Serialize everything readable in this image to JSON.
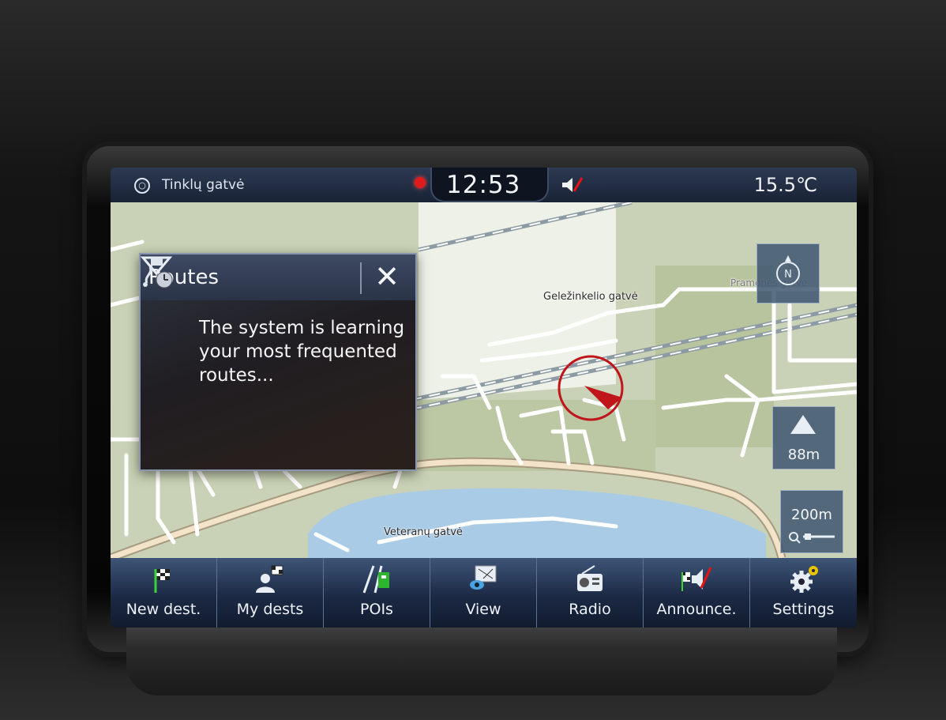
{
  "status_bar": {
    "street": "Tinklų gatvė",
    "time": "12:53",
    "temperature": "15.5℃"
  },
  "map": {
    "streets": {
      "gelezinkelio": "Geležinkelio gatvė",
      "pramones": "Pramonės gatvė",
      "veteranu": "Veteranų gatvė"
    },
    "altitude": "88m",
    "scale": "200m",
    "colors": {
      "land": "#c9d2b6",
      "industrial": "#eef1e8",
      "water": "#a9cbe6",
      "road": "#ffffff",
      "main_road": "#f3e3c8",
      "position_marker": "#c0161b"
    }
  },
  "routes_popup": {
    "title": "Routes",
    "message": "The system is learning your most frequented routes..."
  },
  "bottom_nav": {
    "items": [
      {
        "label": "New dest.",
        "icon": "checkered-flag-icon"
      },
      {
        "label": "My dests",
        "icon": "person-flag-icon"
      },
      {
        "label": "POIs",
        "icon": "poi-icon"
      },
      {
        "label": "View",
        "icon": "view-icon"
      },
      {
        "label": "Radio",
        "icon": "radio-icon"
      },
      {
        "label": "Announce.",
        "icon": "announce-icon"
      },
      {
        "label": "Settings",
        "icon": "gear-icon"
      }
    ]
  }
}
